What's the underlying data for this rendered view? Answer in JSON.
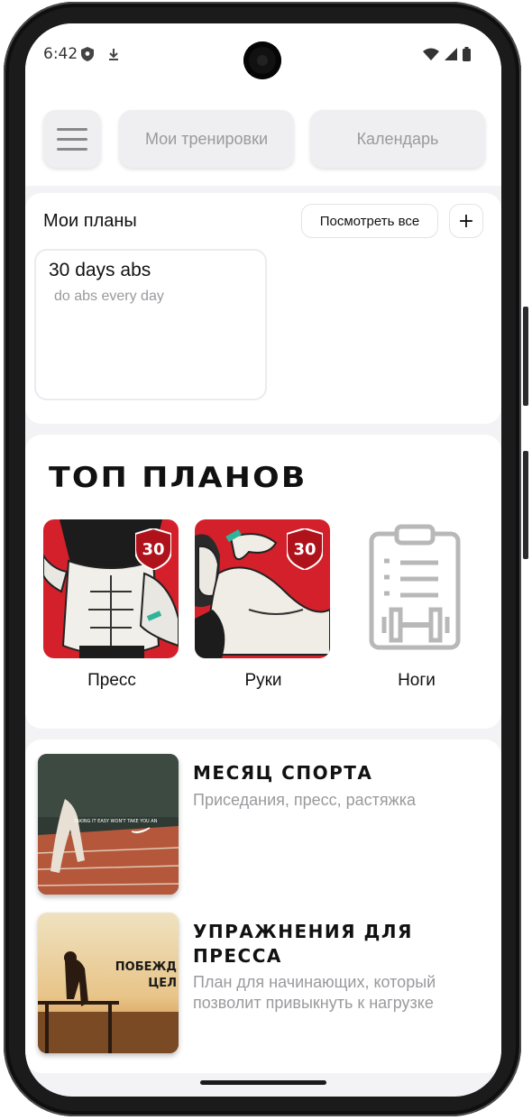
{
  "status_bar": {
    "time": "6:42",
    "icons": [
      "shield-icon",
      "download-icon",
      "wifi-icon",
      "signal-icon",
      "battery-icon"
    ]
  },
  "header": {
    "tabs": [
      {
        "label": "Мои тренировки"
      },
      {
        "label": "Календарь"
      }
    ]
  },
  "my_plans": {
    "title": "Мои планы",
    "view_all_label": "Посмотреть все",
    "add_label": "+",
    "plans": [
      {
        "name": "30 days abs",
        "description": "do abs every day"
      }
    ]
  },
  "top_plans": {
    "title": "ТОП ПЛАНОВ",
    "items": [
      {
        "label": "Пресс",
        "badge": "30"
      },
      {
        "label": "Руки",
        "badge": "30"
      },
      {
        "label": "Ноги"
      }
    ]
  },
  "programs": [
    {
      "title": "МЕСЯЦ СПОРТА",
      "description": "Приседания, пресс, растяжка",
      "image_text": "TAKING IT EASY WON'T TAKE YOU AN"
    },
    {
      "title": "УПРАЖНЕНИЯ ДЛЯ ПРЕССА",
      "description": "План для начинающих, который позволит привыкнуть к нагрузке",
      "image_text_1": "ПОБЕЖД",
      "image_text_2": "ЦЕЛ"
    }
  ],
  "colors": {
    "accent_red": "#d4202a",
    "muted_text": "#9a9a9e",
    "card_bg": "#ffffff",
    "screen_bg": "#f3f2f5"
  }
}
